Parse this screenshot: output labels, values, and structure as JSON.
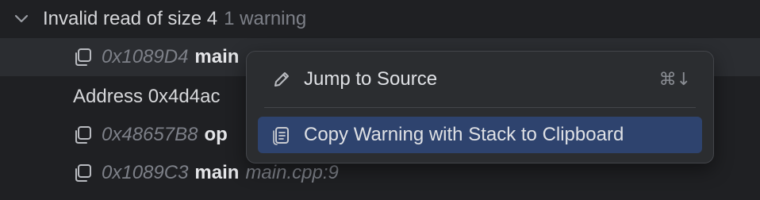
{
  "warning": {
    "title": "Invalid read of size 4",
    "count_label": "1 warning"
  },
  "rows": [
    {
      "address": "0x1089D4",
      "function": "main",
      "file": ""
    },
    {
      "address_text": "Address 0x4d4ac"
    },
    {
      "address": "0x48657B8",
      "function": "op",
      "file": ""
    },
    {
      "address": "0x1089C3",
      "function": "main",
      "file": "main.cpp:9"
    }
  ],
  "context_menu": {
    "items": [
      {
        "label": "Jump to Source",
        "shortcut": "⌘↓",
        "icon": "pencil-icon"
      },
      {
        "label": "Copy Warning with Stack to Clipboard",
        "shortcut": "",
        "icon": "clipboard-icon",
        "highlighted": true
      }
    ]
  },
  "colors": {
    "background": "#1f2023",
    "selected_row": "#2b2d31",
    "menu_background": "#2b2d30",
    "menu_highlight": "#2e436e",
    "text": "#d6d7da",
    "muted_text": "#7d8088"
  }
}
